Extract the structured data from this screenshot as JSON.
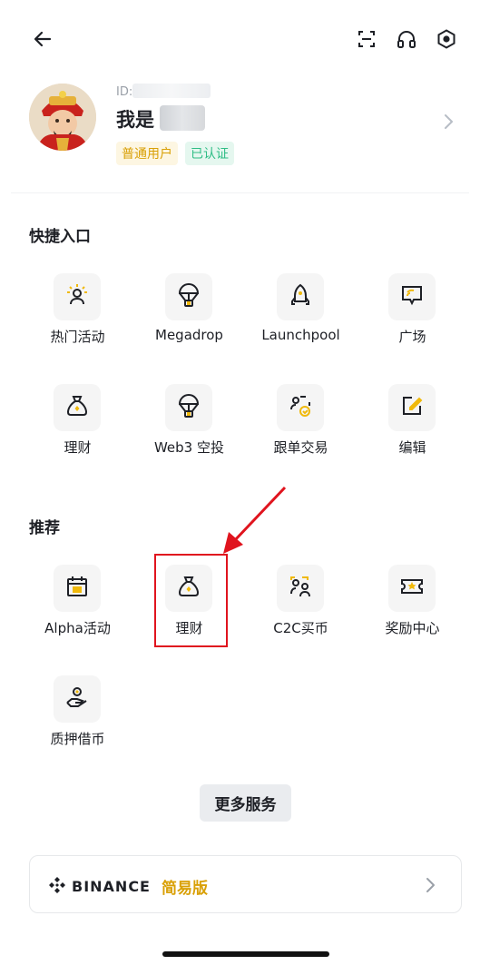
{
  "header": {
    "back_icon": "arrow-left-icon",
    "icons": [
      "scan-icon",
      "headset-icon",
      "hexagon-settings-icon"
    ]
  },
  "profile": {
    "uid_label": "ID:",
    "nickname": "我是",
    "badges": [
      "普通用户",
      "已认证"
    ]
  },
  "shortcuts": {
    "title": "快捷入口",
    "items": [
      {
        "label": "热门活动",
        "icon": "person-sparkle-icon"
      },
      {
        "label": "Megadrop",
        "icon": "parachute-icon"
      },
      {
        "label": "Launchpool",
        "icon": "rocket-icon"
      },
      {
        "label": "广场",
        "icon": "cast-screen-icon"
      },
      {
        "label": "理财",
        "icon": "money-bag-icon"
      },
      {
        "label": "Web3 空投",
        "icon": "parachute-icon"
      },
      {
        "label": "跟单交易",
        "icon": "copy-trade-icon"
      },
      {
        "label": "编辑",
        "icon": "edit-icon"
      }
    ]
  },
  "recommended": {
    "title": "推荐",
    "items": [
      {
        "label": "Alpha活动",
        "icon": "calendar-alpha-icon"
      },
      {
        "label": "理财",
        "icon": "money-bag-icon"
      },
      {
        "label": "C2C买币",
        "icon": "c2c-users-icon"
      },
      {
        "label": "奖励中心",
        "icon": "ticket-star-icon"
      },
      {
        "label": "质押借币",
        "icon": "hand-coin-icon"
      }
    ]
  },
  "more_button": "更多服务",
  "binance_card": {
    "brand": "BINANCE",
    "mode": "简易版"
  },
  "colors": {
    "accent": "#F0B90B",
    "highlight": "#E0141E",
    "verified": "#2EBD85"
  }
}
